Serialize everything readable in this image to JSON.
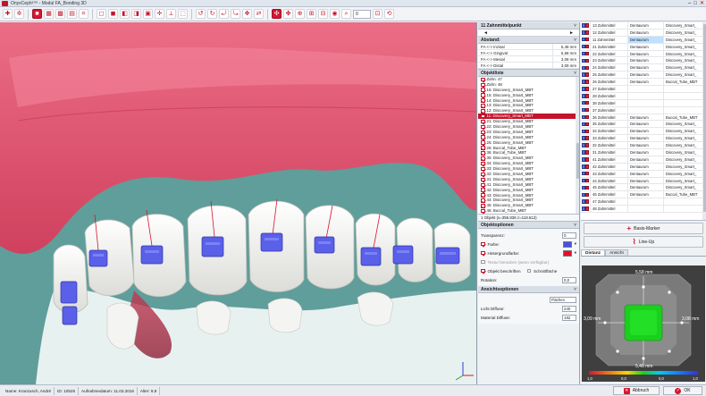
{
  "window": {
    "title": "OnyxCeph³™ - Modul FA_Bonding 3D"
  },
  "toolbar": {
    "zoom_value": "0"
  },
  "mid": {
    "point_header": "11 Zahnmittelpunkt",
    "point_nav": {
      "prev": "◄",
      "next": "►"
    },
    "distance_header": "Abstand:",
    "distances": [
      {
        "label": "FA <-> Inzisal",
        "value": "5,48 mm"
      },
      {
        "label": "FA <-> Gingival",
        "value": "5,58 mm"
      },
      {
        "label": "FA <-> Mesial",
        "value": "3,08 mm"
      },
      {
        "label": "FA <-> Distal",
        "value": "3,09 mm"
      }
    ],
    "objects_header": "Objektliste",
    "objects": [
      {
        "label": "Zahn: 47",
        "checked": true,
        "selected": false
      },
      {
        "label": "Zahn: 48",
        "checked": true,
        "selected": false
      },
      {
        "label": "16: Discovery_Smart_MBT",
        "checked": true,
        "selected": false
      },
      {
        "label": "15: Discovery_Smart_MBT",
        "checked": true,
        "selected": false
      },
      {
        "label": "14: Discovery_Smart_MBT",
        "checked": true,
        "selected": false
      },
      {
        "label": "13: Discovery_Smart_MBT",
        "checked": true,
        "selected": false
      },
      {
        "label": "12: Discovery_Smart_MBT",
        "checked": true,
        "selected": false
      },
      {
        "label": "11: Discovery_Smart_MBT",
        "checked": true,
        "selected": true
      },
      {
        "label": "21: Discovery_Smart_MBT",
        "checked": true,
        "selected": false
      },
      {
        "label": "22: Discovery_Smart_MBT",
        "checked": true,
        "selected": false
      },
      {
        "label": "23: Discovery_Smart_MBT",
        "checked": true,
        "selected": false
      },
      {
        "label": "24: Discovery_Smart_MBT",
        "checked": true,
        "selected": false
      },
      {
        "label": "25: Discovery_Smart_MBT",
        "checked": true,
        "selected": false
      },
      {
        "label": "26: Buccal_Tube_MBT",
        "checked": true,
        "selected": false
      },
      {
        "label": "36: Buccal_Tube_MBT",
        "checked": true,
        "selected": false
      },
      {
        "label": "35: Discovery_Smart_MBT",
        "checked": true,
        "selected": false
      },
      {
        "label": "34: Discovery_Smart_MBT",
        "checked": true,
        "selected": false
      },
      {
        "label": "33: Discovery_Smart_MBT",
        "checked": true,
        "selected": false
      },
      {
        "label": "32: Discovery_Smart_MBT",
        "checked": true,
        "selected": false
      },
      {
        "label": "31: Discovery_Smart_MBT",
        "checked": true,
        "selected": false
      },
      {
        "label": "41: Discovery_Smart_MBT",
        "checked": true,
        "selected": false
      },
      {
        "label": "42: Discovery_Smart_MBT",
        "checked": true,
        "selected": false
      },
      {
        "label": "43: Discovery_Smart_MBT",
        "checked": true,
        "selected": false
      },
      {
        "label": "44: Discovery_Smart_MBT",
        "checked": true,
        "selected": false
      },
      {
        "label": "45: Discovery_Smart_MBT",
        "checked": true,
        "selected": false
      },
      {
        "label": "46: Buccal_Tube_MBT",
        "checked": true,
        "selected": false
      }
    ],
    "selection_status": "1 Objekt (x=355.836 z=118.612)",
    "options_header": "Objektoptionen",
    "options": {
      "transparency_label": "Transparenz:",
      "transparency_value": "0",
      "color_label": "Farbe:",
      "color_value": "#4a4fe0",
      "bgcolor_label": "Hintergrundfarbe:",
      "bgcolor_value": "#e0102b",
      "texture_label": "Textur benutzen (wenn verfügbar)",
      "label_label": "Objekt beschriften",
      "cutface_label": "Schnittfläche",
      "rotation_label": "Rotation:",
      "rotation_value": "0,0"
    },
    "view_header": "Ansichtsoptionen",
    "view": {
      "surface_value": "Flächen",
      "light_label": "Licht Diffuse:",
      "light_value": "240",
      "material_label": "Material Diffuse:",
      "material_value": "192"
    }
  },
  "right": {
    "rows": [
      {
        "n": "13 Zahnmittel",
        "c2": "Dentaurum",
        "c3": "Discovery_Smart_",
        "hl": false
      },
      {
        "n": "12 Zahnmittel",
        "c2": "Dentaurum",
        "c3": "Discovery_Smart_",
        "hl": false
      },
      {
        "n": "11 Zahnmittel",
        "c2": "Dentaurum",
        "c3": "Discovery_Smart_",
        "hl": true
      },
      {
        "n": "21 Zahnmittel",
        "c2": "Dentaurum",
        "c3": "Discovery_Smart_",
        "hl": false
      },
      {
        "n": "22 Zahnmittel",
        "c2": "Dentaurum",
        "c3": "Discovery_Smart_",
        "hl": false
      },
      {
        "n": "23 Zahnmittel",
        "c2": "Dentaurum",
        "c3": "Discovery_Smart_",
        "hl": false
      },
      {
        "n": "24 Zahnmittel",
        "c2": "Dentaurum",
        "c3": "Discovery_Smart_",
        "hl": false
      },
      {
        "n": "25 Zahnmittel",
        "c2": "Dentaurum",
        "c3": "Discovery_Smart_",
        "hl": false
      },
      {
        "n": "26 Zahnmittel",
        "c2": "Dentaurum",
        "c3": "Buccal_Tube_MBT",
        "hl": false
      },
      {
        "n": "27 Zahnmittel",
        "c2": "",
        "c3": "",
        "hl": false
      },
      {
        "n": "28 Zahnmittel",
        "c2": "",
        "c3": "",
        "hl": false
      },
      {
        "n": "38 Zahnmittel",
        "c2": "",
        "c3": "",
        "hl": false
      },
      {
        "n": "37 Zahnmittel",
        "c2": "",
        "c3": "",
        "hl": false
      },
      {
        "n": "36 Zahnmittel",
        "c2": "Dentaurum",
        "c3": "Buccal_Tube_MBT",
        "hl": false
      },
      {
        "n": "35 Zahnmittel",
        "c2": "Dentaurum",
        "c3": "Discovery_Smart_",
        "hl": false
      },
      {
        "n": "34 Zahnmittel",
        "c2": "Dentaurum",
        "c3": "Discovery_Smart_",
        "hl": false
      },
      {
        "n": "33 Zahnmittel",
        "c2": "Dentaurum",
        "c3": "Discovery_Smart_",
        "hl": false
      },
      {
        "n": "32 Zahnmittel",
        "c2": "Dentaurum",
        "c3": "Discovery_Smart_",
        "hl": false
      },
      {
        "n": "31 Zahnmittel",
        "c2": "Dentaurum",
        "c3": "Discovery_Smart_",
        "hl": false
      },
      {
        "n": "41 Zahnmittel",
        "c2": "Dentaurum",
        "c3": "Discovery_Smart_",
        "hl": false
      },
      {
        "n": "42 Zahnmittel",
        "c2": "Dentaurum",
        "c3": "Discovery_Smart_",
        "hl": false
      },
      {
        "n": "43 Zahnmittel",
        "c2": "Dentaurum",
        "c3": "Discovery_Smart_",
        "hl": false
      },
      {
        "n": "44 Zahnmittel",
        "c2": "Dentaurum",
        "c3": "Discovery_Smart_",
        "hl": false
      },
      {
        "n": "45 Zahnmittel",
        "c2": "Dentaurum",
        "c3": "Discovery_Smart_",
        "hl": false
      },
      {
        "n": "46 Zahnmittel",
        "c2": "Dentaurum",
        "c3": "Buccal_Tube_MBT",
        "hl": false
      },
      {
        "n": "47 Zahnmittel",
        "c2": "",
        "c3": "",
        "hl": false
      },
      {
        "n": "48 Zahnmittel",
        "c2": "",
        "c3": "",
        "hl": false
      }
    ],
    "basis_marker_label": "Basis-Marker",
    "lineup_label": "Line-Up",
    "tabs": [
      "Distanz",
      "Ansicht"
    ],
    "dist_panel": {
      "top": "5,58 mm",
      "left": "3,09 mm",
      "right": "3,08 mm",
      "bottom": "5,48 mm",
      "scale_left": "1,0",
      "scale_mid_left": "0,0",
      "scale_mid_right": "0,0",
      "scale_right": "1,0"
    }
  },
  "footer": {
    "name": "Name: Kranzusch, André",
    "id": "ID: 10525",
    "date": "Aufnahmedatum: 11.03.2016",
    "age": "Alter: 9,9",
    "cancel_label": "Abbruch",
    "ok_label": "OK"
  },
  "colors": {
    "accent": "#c3142b",
    "bracket": "#5a60e8",
    "gingiva": "#e24a66",
    "background": "#5f9e9a"
  }
}
